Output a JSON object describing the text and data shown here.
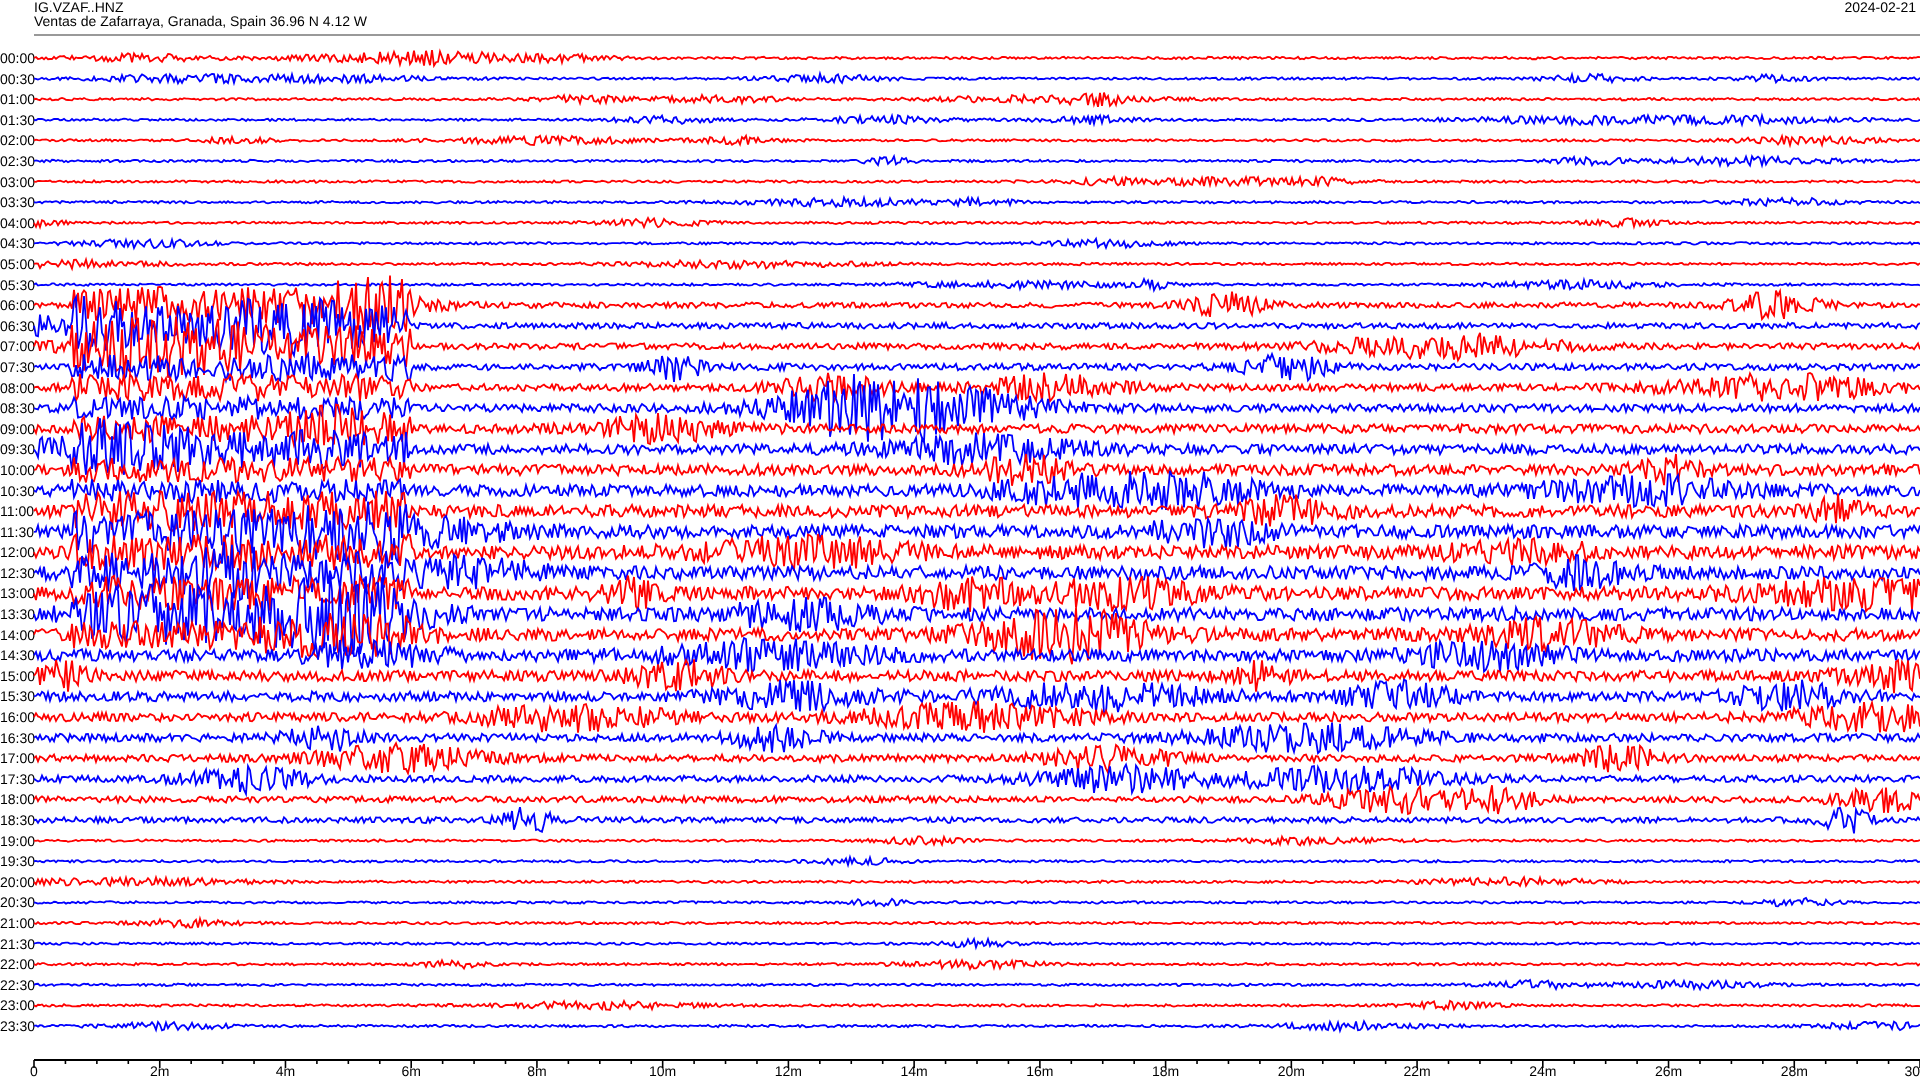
{
  "header": {
    "station": "IG.VZAF..HNZ",
    "location": "Ventas de Zafarraya, Granada, Spain  36.96 N 4.12 W",
    "date": "2024-02-21"
  },
  "rows": [
    {
      "label": "00:00",
      "color": "#ff0000"
    },
    {
      "label": "00:30",
      "color": "#0000ff"
    },
    {
      "label": "01:00",
      "color": "#ff0000"
    },
    {
      "label": "01:30",
      "color": "#0000ff"
    },
    {
      "label": "02:00",
      "color": "#ff0000"
    },
    {
      "label": "02:30",
      "color": "#0000ff"
    },
    {
      "label": "03:00",
      "color": "#ff0000"
    },
    {
      "label": "03:30",
      "color": "#0000ff"
    },
    {
      "label": "04:00",
      "color": "#ff0000"
    },
    {
      "label": "04:30",
      "color": "#0000ff"
    },
    {
      "label": "05:00",
      "color": "#ff0000"
    },
    {
      "label": "05:30",
      "color": "#0000ff"
    },
    {
      "label": "06:00",
      "color": "#ff0000"
    },
    {
      "label": "06:30",
      "color": "#0000ff"
    },
    {
      "label": "07:00",
      "color": "#ff0000"
    },
    {
      "label": "07:30",
      "color": "#0000ff"
    },
    {
      "label": "08:00",
      "color": "#ff0000"
    },
    {
      "label": "08:30",
      "color": "#0000ff"
    },
    {
      "label": "09:00",
      "color": "#ff0000"
    },
    {
      "label": "09:30",
      "color": "#0000ff"
    },
    {
      "label": "10:00",
      "color": "#ff0000"
    },
    {
      "label": "10:30",
      "color": "#0000ff"
    },
    {
      "label": "11:00",
      "color": "#ff0000"
    },
    {
      "label": "11:30",
      "color": "#0000ff"
    },
    {
      "label": "12:00",
      "color": "#ff0000"
    },
    {
      "label": "12:30",
      "color": "#0000ff"
    },
    {
      "label": "13:00",
      "color": "#ff0000"
    },
    {
      "label": "13:30",
      "color": "#0000ff"
    },
    {
      "label": "14:00",
      "color": "#ff0000"
    },
    {
      "label": "14:30",
      "color": "#0000ff"
    },
    {
      "label": "15:00",
      "color": "#ff0000"
    },
    {
      "label": "15:30",
      "color": "#0000ff"
    },
    {
      "label": "16:00",
      "color": "#ff0000"
    },
    {
      "label": "16:30",
      "color": "#0000ff"
    },
    {
      "label": "17:00",
      "color": "#ff0000"
    },
    {
      "label": "17:30",
      "color": "#0000ff"
    },
    {
      "label": "18:00",
      "color": "#ff0000"
    },
    {
      "label": "18:30",
      "color": "#0000ff"
    },
    {
      "label": "19:00",
      "color": "#ff0000"
    },
    {
      "label": "19:30",
      "color": "#0000ff"
    },
    {
      "label": "20:00",
      "color": "#ff0000"
    },
    {
      "label": "20:30",
      "color": "#0000ff"
    },
    {
      "label": "21:00",
      "color": "#ff0000"
    },
    {
      "label": "21:30",
      "color": "#0000ff"
    },
    {
      "label": "22:00",
      "color": "#ff0000"
    },
    {
      "label": "22:30",
      "color": "#0000ff"
    },
    {
      "label": "23:00",
      "color": "#ff0000"
    },
    {
      "label": "23:30",
      "color": "#0000ff"
    }
  ],
  "x_axis": [
    "0",
    "2m",
    "4m",
    "6m",
    "8m",
    "10m",
    "12m",
    "14m",
    "16m",
    "18m",
    "20m",
    "22m",
    "24m",
    "26m",
    "28m",
    "30"
  ]
}
